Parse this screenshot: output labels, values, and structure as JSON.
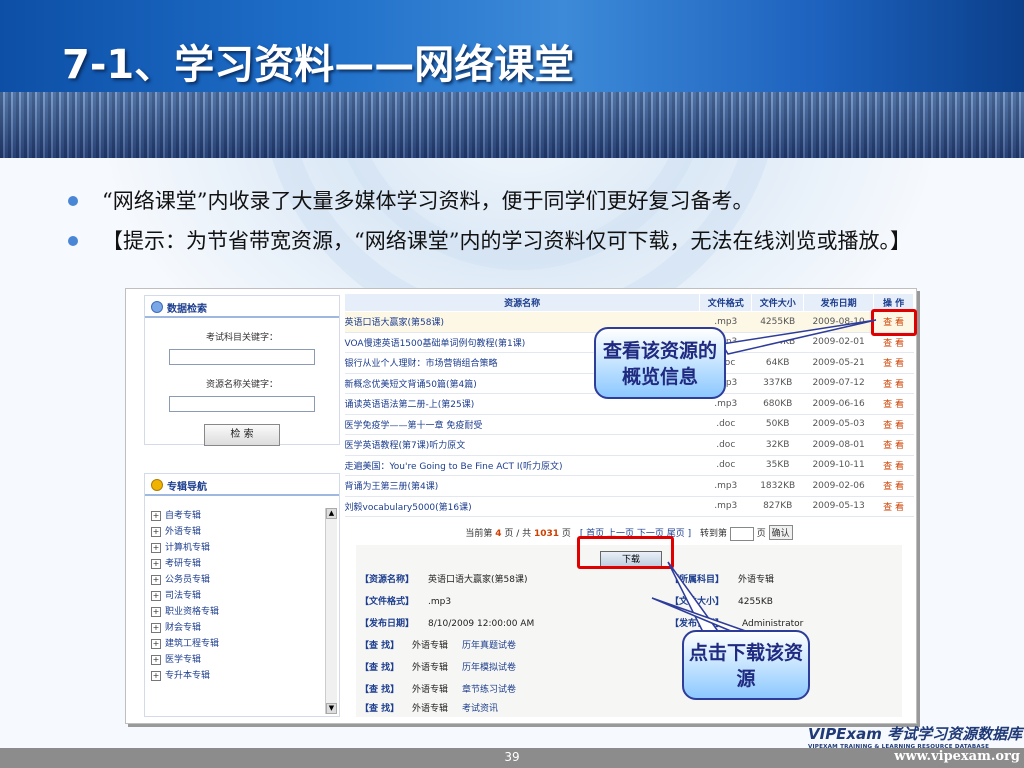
{
  "slide": {
    "title": "7-1、学习资料——网络课堂",
    "bullets": [
      "“网络课堂”内收录了大量多媒体学习资料，便于同学们更好复习备考。",
      "【提示：为节省带宽资源，“网络课堂”内的学习资料仅可下载，无法在线浏览或播放。】"
    ],
    "page_number": "39",
    "site": "www.vipexam.org",
    "logo": {
      "main": "VIPExam 考试学习资源数据库",
      "sub": "VIPEXAM TRAINING & LEARNING RESOURCE DATABASE"
    }
  },
  "search": {
    "title": "数据检索",
    "subject_label": "考试科目关键字：",
    "resource_label": "资源名称关键字：",
    "button": "检 索"
  },
  "nav": {
    "title": "专辑导航",
    "items": [
      "自考专辑",
      "外语专辑",
      "计算机专辑",
      "考研专辑",
      "公务员专辑",
      "司法专辑",
      "职业资格专辑",
      "财会专辑",
      "建筑工程专辑",
      "医学专辑",
      "专升本专辑"
    ]
  },
  "table": {
    "headers": [
      "资源名称",
      "文件格式",
      "文件大小",
      "发布日期",
      "操 作"
    ],
    "rows": [
      {
        "name": "英语口语大赢家(第58课)",
        "format": ".mp3",
        "size": "4255KB",
        "date": "2009-08-10",
        "op": "查 看"
      },
      {
        "name": "VOA慢速英语1500基础单词例句教程(第1课)",
        "format": ".mp3",
        "size": "5574KB",
        "date": "2009-02-01",
        "op": "查 看"
      },
      {
        "name": "银行从业个人理财：市场营销组合策略",
        "format": ".doc",
        "size": "64KB",
        "date": "2009-05-21",
        "op": "查 看"
      },
      {
        "name": "新概念优美短文背诵50篇(第4篇)",
        "format": ".mp3",
        "size": "337KB",
        "date": "2009-07-12",
        "op": "查 看"
      },
      {
        "name": "诵读英语语法第二册-上(第25课)",
        "format": ".mp3",
        "size": "680KB",
        "date": "2009-06-16",
        "op": "查 看"
      },
      {
        "name": "医学免疫学——第十一章 免疫耐受",
        "format": ".doc",
        "size": "50KB",
        "date": "2009-05-03",
        "op": "查 看"
      },
      {
        "name": "医学英语教程(第7课)听力原文",
        "format": ".doc",
        "size": "32KB",
        "date": "2009-08-01",
        "op": "查 看"
      },
      {
        "name": "走遍美国：You're Going to Be Fine ACT I(听力原文)",
        "format": ".doc",
        "size": "35KB",
        "date": "2009-10-11",
        "op": "查 看"
      },
      {
        "name": "背诵为王第三册(第4课)",
        "format": ".mp3",
        "size": "1832KB",
        "date": "2009-02-06",
        "op": "查 看"
      },
      {
        "name": "刘毅vocabulary5000(第16课)",
        "format": ".mp3",
        "size": "827KB",
        "date": "2009-05-13",
        "op": "查 看"
      }
    ]
  },
  "pager": {
    "prefix": "当前第",
    "page": "4",
    "sep": "页 / 共",
    "total": "1031",
    "suffix": "页",
    "nav": "[ 首页 上一页 下一页 尾页 ]",
    "goto": "转到第",
    "unit": "页",
    "confirm": "确认"
  },
  "detail": {
    "download": "下载",
    "name_k": "【资源名称】",
    "name_v": "英语口语大赢家(第58课)",
    "subject_k": "【所属科目】",
    "subject_v": "外语专辑",
    "format_k": "【文件格式】",
    "format_v": ".mp3",
    "size_k": "【文件大小】",
    "size_v": "4255KB",
    "date_k": "【发布日期】",
    "date_v": "8/10/2009 12:00:00 AM",
    "author_k": "【发布作者】",
    "author_v": "Administrator",
    "find_k": "【查 找】",
    "finds": [
      {
        "cat": "外语专辑",
        "item": "历年真题试卷"
      },
      {
        "cat": "外语专辑",
        "item": "历年模拟试卷"
      },
      {
        "cat": "外语专辑",
        "item": "章节练习试卷"
      },
      {
        "cat": "外语专辑",
        "item": "考试资讯"
      }
    ]
  },
  "callouts": {
    "view": "查看该资源的概览信息",
    "download": "点击下载该资源"
  }
}
